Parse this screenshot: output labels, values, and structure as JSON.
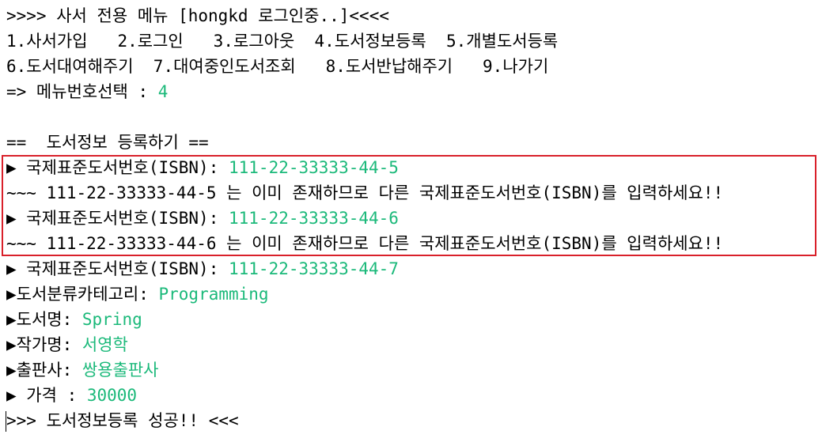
{
  "colors": {
    "input": "#1bb97a",
    "highlight_border": "#d9202a",
    "text": "#000000"
  },
  "menu": {
    "header": ">>>> 사서 전용 메뉴 [hongkd 로그인중..]<<<<",
    "row1": "1.사서가입   2.로그인   3.로그아웃  4.도서정보등록  5.개별도서등록",
    "row2": "6.도서대여해주기  7.대여중인도서조회   8.도서반납해주기   9.나가기",
    "select_prompt": "=> 메뉴번호선택 : ",
    "select_value": "4"
  },
  "section_title": "==  도서정보 등록하기 ==",
  "attempts": [
    {
      "prompt": "▶ 국제표준도서번호(ISBN): ",
      "value": "111-22-33333-44-5",
      "error": "~~~ 111-22-33333-44-5 는 이미 존재하므로 다른 국제표준도서번호(ISBN)를 입력하세요!!"
    },
    {
      "prompt": "▶ 국제표준도서번호(ISBN): ",
      "value": "111-22-33333-44-6",
      "error": "~~~ 111-22-33333-44-6 는 이미 존재하므로 다른 국제표준도서번호(ISBN)를 입력하세요!!"
    }
  ],
  "fields": [
    {
      "prompt": "▶ 국제표준도서번호(ISBN): ",
      "value": "111-22-33333-44-7"
    },
    {
      "prompt": "▶도서분류카테고리: ",
      "value": "Programming"
    },
    {
      "prompt": "▶도서명: ",
      "value": "Spring"
    },
    {
      "prompt": "▶작가명: ",
      "value": "서영학"
    },
    {
      "prompt": "▶출판사: ",
      "value": "쌍용출판사"
    },
    {
      "prompt": "▶ 가격 : ",
      "value": "30000"
    }
  ],
  "result": ">>> 도서정보등록 성공!! <<<"
}
